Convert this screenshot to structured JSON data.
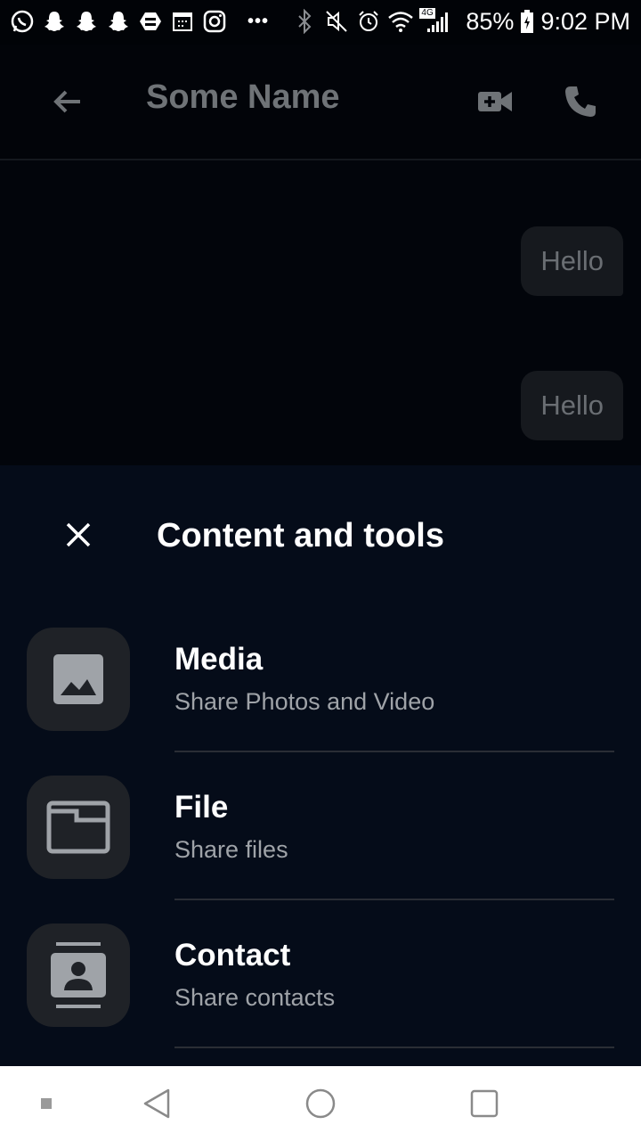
{
  "status_bar": {
    "battery": "85%",
    "time": "9:02 PM",
    "more": "•••",
    "network": "4G",
    "left_icons": [
      "whatsapp-icon",
      "snapchat-icon",
      "snapchat-icon",
      "snapchat-icon",
      "app-icon",
      "calendar-icon",
      "instagram-icon"
    ],
    "right_icons": [
      "bluetooth-icon",
      "mute-icon",
      "alarm-icon",
      "wifi-icon",
      "signal-icon",
      "battery-icon"
    ]
  },
  "header": {
    "title": "Some Name",
    "icons": [
      "arrow-left-icon",
      "video-call-icon",
      "phone-icon"
    ]
  },
  "messages": [
    {
      "text": "Hello",
      "side": "sent"
    },
    {
      "text": "Hello",
      "side": "sent"
    }
  ],
  "sheet": {
    "title": "Content and tools",
    "close_icon": "close-icon",
    "options": [
      {
        "title": "Media",
        "subtitle": "Share Photos and Video",
        "icon": "image-icon"
      },
      {
        "title": "File",
        "subtitle": "Share files",
        "icon": "folder-icon"
      },
      {
        "title": "Contact",
        "subtitle": "Share contacts",
        "icon": "contact-card-icon"
      }
    ]
  },
  "nav_bar": {
    "icons": [
      "square-dot-icon",
      "back-triangle-icon",
      "home-circle-icon",
      "recents-square-icon"
    ]
  },
  "colors": {
    "sheet_background": "#050c19",
    "tile_background": "#1f2227",
    "bubble_background": "#16191e",
    "secondary_text": "#9fa3a8"
  }
}
